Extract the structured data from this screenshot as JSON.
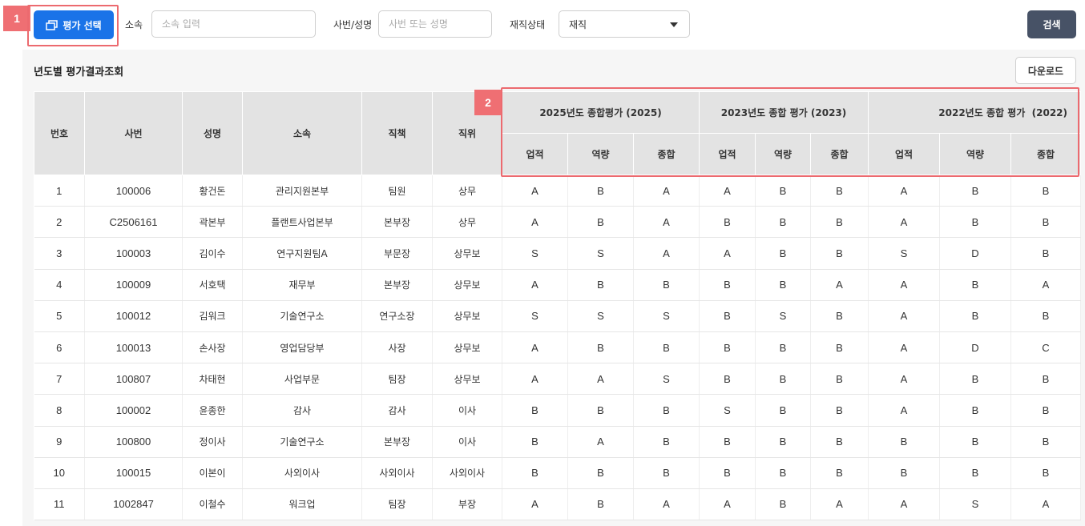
{
  "annotations": {
    "badge1": "1",
    "badge2": "2"
  },
  "toolbar": {
    "eval_select_label": "평가 선택",
    "affiliation_label": "소속",
    "affiliation_placeholder": "소속 입력",
    "emp_label": "사번/성명",
    "emp_placeholder": "사번 또는 성명",
    "status_label": "재직상태",
    "status_value": "재직",
    "search_label": "검색"
  },
  "section": {
    "title": "년도별 평가결과조회",
    "download_label": "다운로드"
  },
  "table": {
    "fixed_headers": [
      "번호",
      "사번",
      "성명",
      "소속",
      "직책",
      "직위"
    ],
    "year_groups": [
      "2025년도 종합평가 (2025)",
      "2023년도 종합 평가 (2023)",
      "2022년도 종합 평가  (2022)"
    ],
    "sub_headers": [
      "업적",
      "역량",
      "종합"
    ],
    "rows": [
      [
        "1",
        "100006",
        "황건돈",
        "관리지원본부",
        "팀원",
        "상무",
        "A",
        "B",
        "A",
        "A",
        "B",
        "B",
        "A",
        "B",
        "B"
      ],
      [
        "2",
        "C2506161",
        "곽본부",
        "플랜트사업본부",
        "본부장",
        "상무",
        "A",
        "B",
        "A",
        "B",
        "B",
        "B",
        "A",
        "B",
        "B"
      ],
      [
        "3",
        "100003",
        "김이수",
        "연구지원팀A",
        "부문장",
        "상무보",
        "S",
        "S",
        "A",
        "A",
        "B",
        "B",
        "S",
        "D",
        "B"
      ],
      [
        "4",
        "100009",
        "서호택",
        "재무부",
        "본부장",
        "상무보",
        "A",
        "B",
        "B",
        "B",
        "B",
        "A",
        "A",
        "B",
        "A"
      ],
      [
        "5",
        "100012",
        "김워크",
        "기술연구소",
        "연구소장",
        "상무보",
        "S",
        "S",
        "S",
        "B",
        "S",
        "B",
        "A",
        "B",
        "B"
      ],
      [
        "6",
        "100013",
        "손사장",
        "영업담당부",
        "사장",
        "상무보",
        "A",
        "B",
        "B",
        "B",
        "B",
        "B",
        "A",
        "D",
        "C"
      ],
      [
        "7",
        "100807",
        "차태현",
        "사업부문",
        "팀장",
        "상무보",
        "A",
        "A",
        "S",
        "B",
        "B",
        "B",
        "A",
        "B",
        "B"
      ],
      [
        "8",
        "100002",
        "윤종한",
        "감사",
        "감사",
        "이사",
        "B",
        "B",
        "B",
        "S",
        "B",
        "B",
        "A",
        "B",
        "B"
      ],
      [
        "9",
        "100800",
        "정이사",
        "기술연구소",
        "본부장",
        "이사",
        "B",
        "A",
        "B",
        "B",
        "B",
        "B",
        "B",
        "B",
        "B"
      ],
      [
        "10",
        "100015",
        "이본이",
        "사외이사",
        "사외이사",
        "사외이사",
        "B",
        "B",
        "B",
        "B",
        "B",
        "B",
        "B",
        "B",
        "B"
      ],
      [
        "11",
        "1002847",
        "이철수",
        "워크업",
        "팀장",
        "부장",
        "A",
        "B",
        "A",
        "A",
        "B",
        "A",
        "A",
        "S",
        "A"
      ]
    ]
  },
  "colors": {
    "primary": "#1a73e8",
    "search_button": "#475266",
    "annotation": "#ef6f73",
    "header_bg": "#e3e3e3"
  }
}
